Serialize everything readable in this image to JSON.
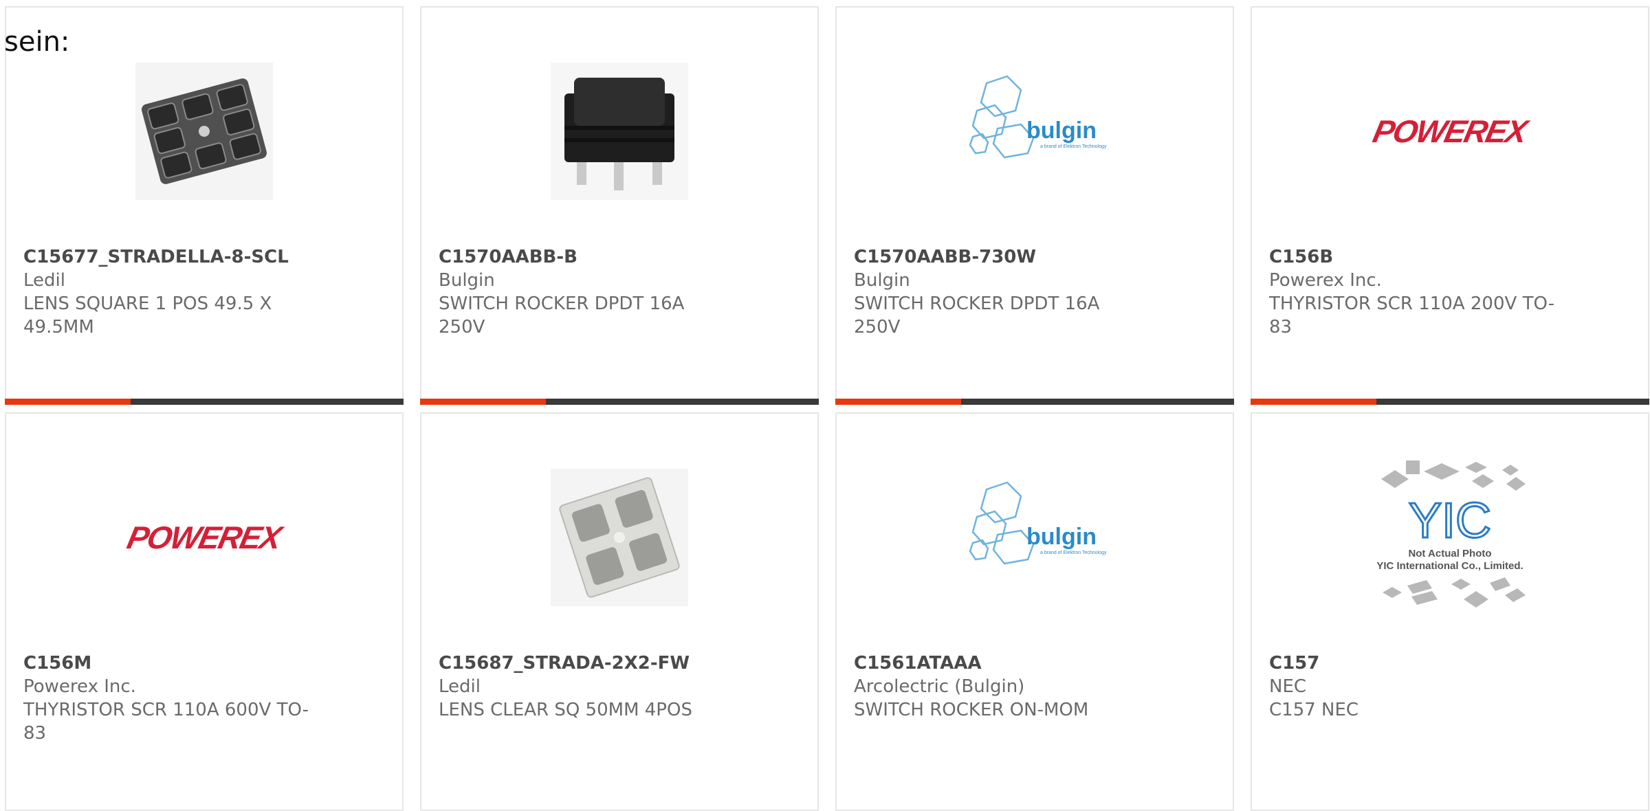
{
  "intro": "sein:",
  "colors": {
    "accent": "#e8380d",
    "bar": "#3a3a3a",
    "powerex": "#d61f36",
    "bulgin": "#2a8bc9"
  },
  "cards": [
    {
      "part": "C15677_STRADELLA-8-SCL",
      "maker": "Ledil",
      "desc": "LENS SQUARE 1 POS 49.5 X 49.5MM",
      "image": "lens-array-photo"
    },
    {
      "part": "C1570AABB-B",
      "maker": "Bulgin",
      "desc": "SWITCH ROCKER DPDT 16A 250V",
      "image": "rocker-switch-photo"
    },
    {
      "part": "C1570AABB-730W",
      "maker": "Bulgin",
      "desc": "SWITCH ROCKER DPDT 16A 250V",
      "image": "bulgin-logo",
      "logo_text": "bulgin",
      "logo_sub": "a brand of Elektron Technology"
    },
    {
      "part": "C156B",
      "maker": "Powerex Inc.",
      "desc": "THYRISTOR SCR 110A 200V TO-83",
      "image": "powerex-logo",
      "logo_text": "POWEREX"
    },
    {
      "part": "C156M",
      "maker": "Powerex Inc.",
      "desc": "THYRISTOR SCR 110A 600V TO-83",
      "image": "powerex-logo",
      "logo_text": "POWEREX"
    },
    {
      "part": "C15687_STRADA-2X2-FW",
      "maker": "Ledil",
      "desc": "LENS CLEAR SQ 50MM 4POS",
      "image": "clear-lens-photo"
    },
    {
      "part": "C1561ATAAA",
      "maker": "Arcolectric (Bulgin)",
      "desc": "SWITCH ROCKER ON-MOM",
      "image": "bulgin-logo",
      "logo_text": "bulgin",
      "logo_sub": "a brand of Elektron Technology"
    },
    {
      "part": "C157",
      "maker": "NEC",
      "desc": "C157 NEC",
      "image": "not-actual-photo",
      "logo_text": "YIC",
      "note1": "Not Actual Photo",
      "note2": "YIC International Co., Limited."
    }
  ]
}
